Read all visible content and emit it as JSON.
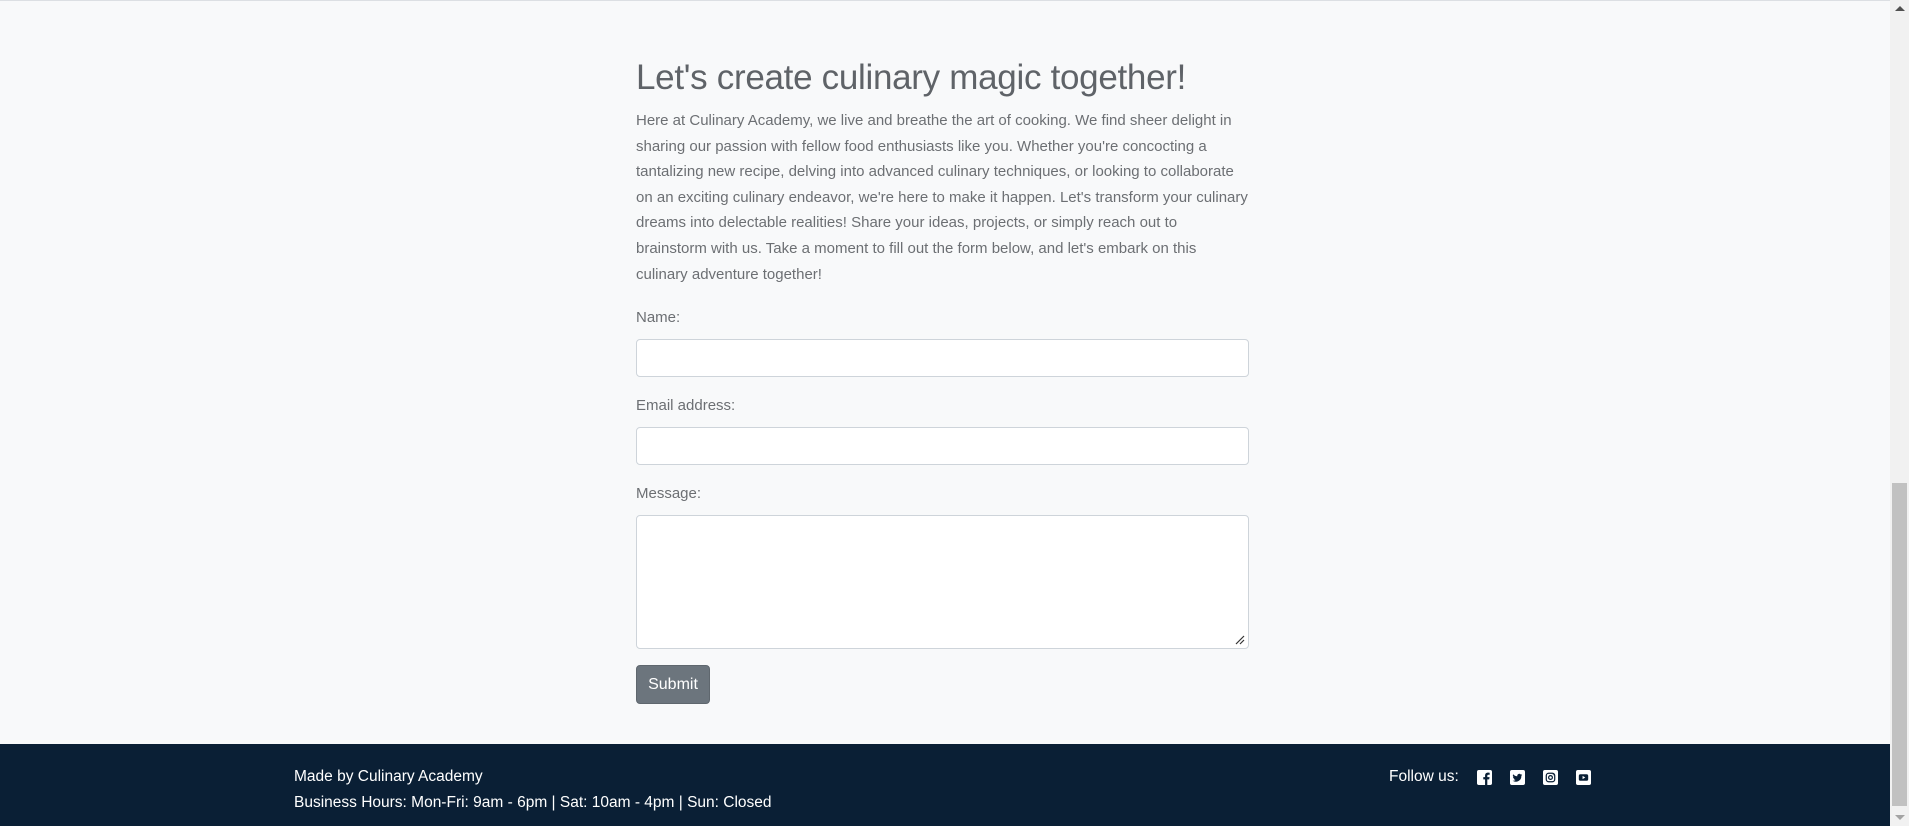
{
  "contact": {
    "heading": "Let's create culinary magic together!",
    "intro": "Here at Culinary Academy, we live and breathe the art of cooking. We find sheer delight in sharing our passion with fellow food enthusiasts like you. Whether you're concocting a tantalizing new recipe, delving into advanced culinary techniques, or looking to collaborate on an exciting culinary endeavor, we're here to make it happen. Let's transform your culinary dreams into delectable realities! Share your ideas, projects, or simply reach out to brainstorm with us. Take a moment to fill out the form below, and let's embark on this culinary adventure together!",
    "form": {
      "name_label": "Name:",
      "name_value": "",
      "email_label": "Email address:",
      "email_value": "",
      "message_label": "Message:",
      "message_value": "",
      "submit_label": "Submit"
    }
  },
  "footer": {
    "made_by": "Made by Culinary Academy",
    "hours": "Business Hours: Mon-Fri: 9am - 6pm | Sat: 10am - 4pm | Sun: Closed",
    "follow_label": "Follow us:",
    "social_icons": [
      "facebook-icon",
      "twitter-icon",
      "instagram-icon",
      "youtube-icon"
    ]
  },
  "colors": {
    "page_background": "#f8f9fa",
    "footer_background": "#0a1f35",
    "button_background": "#6c757d",
    "text": "#6c6f73"
  }
}
